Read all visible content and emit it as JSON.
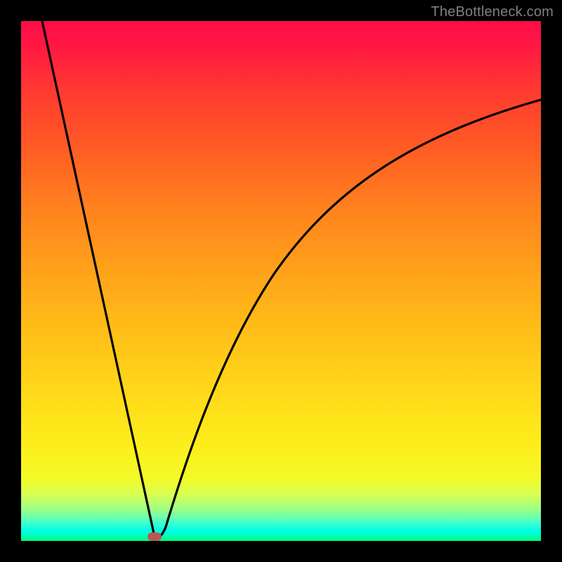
{
  "watermark": "TheBottleneck.com",
  "marker": {
    "x_pct": 25.7,
    "y_pct": 99.2,
    "color": "#b55c52"
  },
  "chart_data": {
    "type": "line",
    "title": "",
    "xlabel": "",
    "ylabel": "",
    "xlim": [
      0,
      100
    ],
    "ylim": [
      0,
      100
    ],
    "grid": false,
    "legend": false,
    "series": [
      {
        "name": "left-branch",
        "x": [
          4,
          7,
          10,
          13,
          16,
          19,
          22,
          25,
          25.7
        ],
        "y": [
          100,
          86,
          72,
          58,
          44,
          30,
          16,
          3,
          0
        ]
      },
      {
        "name": "right-branch",
        "x": [
          25.7,
          27,
          29,
          31,
          34,
          38,
          43,
          49,
          56,
          64,
          73,
          83,
          94,
          100
        ],
        "y": [
          0,
          7,
          16,
          24,
          33,
          42,
          51,
          58,
          65,
          71,
          76,
          80,
          83,
          85
        ]
      }
    ],
    "background_gradient": {
      "direction": "vertical",
      "stops": [
        {
          "pos": 0.0,
          "color": "#ff0b48"
        },
        {
          "pos": 0.25,
          "color": "#ff5e24"
        },
        {
          "pos": 0.5,
          "color": "#ffa81a"
        },
        {
          "pos": 0.75,
          "color": "#ffe019"
        },
        {
          "pos": 0.93,
          "color": "#c8ff60"
        },
        {
          "pos": 1.0,
          "color": "#00ff7a"
        }
      ]
    },
    "annotations": [
      {
        "type": "marker",
        "x": 25.7,
        "y": 0,
        "shape": "pill",
        "color": "#b55c52"
      }
    ]
  }
}
